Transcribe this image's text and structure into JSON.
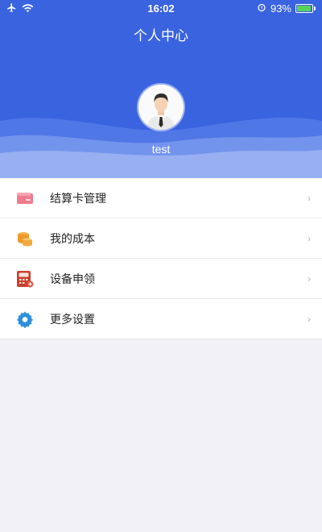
{
  "status_bar": {
    "time": "16:02",
    "battery_percent": "93%",
    "battery_level": 0.93
  },
  "header": {
    "title": "个人中心",
    "username": "test",
    "background_color": "#3a63e0"
  },
  "menu": {
    "items": [
      {
        "label": "结算卡管理",
        "icon": "card-icon",
        "chevron": "›"
      },
      {
        "label": "我的成本",
        "icon": "coins-icon",
        "chevron": "›"
      },
      {
        "label": "设备申领",
        "icon": "pos-terminal-icon",
        "chevron": "›"
      },
      {
        "label": "更多设置",
        "icon": "gear-icon",
        "chevron": "›"
      }
    ]
  }
}
